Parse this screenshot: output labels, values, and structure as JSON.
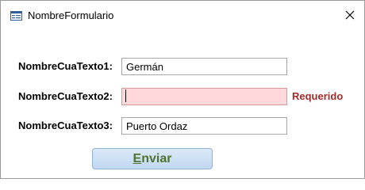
{
  "window": {
    "title": "NombreFormulario",
    "icon": "form-icon",
    "close_icon": "close-icon"
  },
  "form": {
    "fields": [
      {
        "label": "NombreCuaTexto1:",
        "value": "Germán"
      },
      {
        "label": "NombreCuaTexto2:",
        "value": "",
        "validation_message": "Requerido"
      },
      {
        "label": "NombreCuaTexto3:",
        "value": "Puerto Ordaz"
      }
    ],
    "submit": {
      "mnemonic": "E",
      "label_rest": "nviar"
    }
  },
  "colors": {
    "invalid_field_background": "#ffd9d9",
    "validation_text": "#a52a2a",
    "button_text": "#4e7230",
    "button_background": "#c2d8f0"
  }
}
